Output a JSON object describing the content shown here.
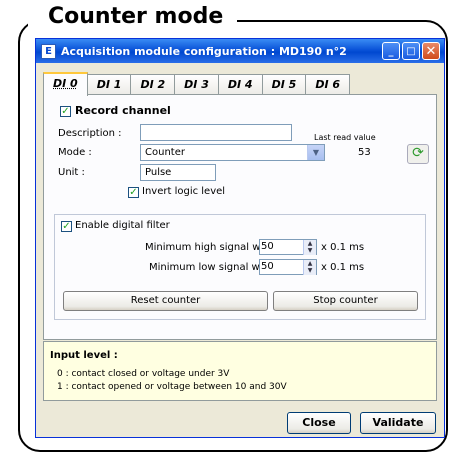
{
  "heading": "Counter mode",
  "window": {
    "title": "Acquisition module configuration : MD190 n°2",
    "icon_label": "E",
    "controls": {
      "minimize": "_",
      "maximize": "□",
      "close": "✕"
    }
  },
  "tabs": [
    "DI 0",
    "DI 1",
    "DI 2",
    "DI 3",
    "DI 4",
    "DI 5",
    "DI 6"
  ],
  "channel": {
    "record_label": "Record channel",
    "record_checked": true,
    "description_label": "Description :",
    "description_value": "",
    "mode_label": "Mode :",
    "mode_value": "Counter",
    "unit_label": "Unit :",
    "unit_value": "Pulse",
    "last_read_label": "Last read value",
    "last_read_value": "53",
    "invert_label": "Invert logic level",
    "invert_checked": true
  },
  "filter": {
    "enable_label": "Enable digital filter",
    "enable_checked": true,
    "min_high_label": "Minimum high signal width :",
    "min_high_value": "50",
    "min_low_label": "Minimum low signal width :",
    "min_low_value": "50",
    "unit_label": "x 0.1 ms",
    "reset_button": "Reset counter",
    "stop_button": "Stop counter"
  },
  "input_level": {
    "title": "Input level :",
    "line0": "0 : contact closed or voltage under 3V",
    "line1": "1 : contact opened or voltage between 10 and 30V"
  },
  "footer": {
    "close_button": "Close",
    "validate_button": "Validate"
  },
  "colors": {
    "titlebar": "#0a53d8",
    "dialog_bg": "#ece9d8",
    "info_bg": "#ffffe1",
    "check": "#21a121"
  }
}
